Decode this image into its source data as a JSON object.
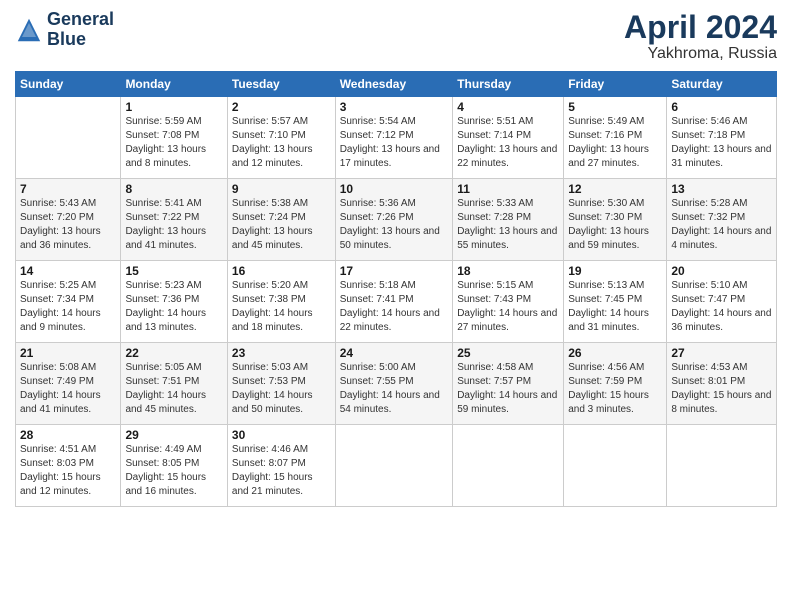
{
  "header": {
    "logo_line1": "General",
    "logo_line2": "Blue",
    "month_year": "April 2024",
    "location": "Yakhroma, Russia"
  },
  "weekdays": [
    "Sunday",
    "Monday",
    "Tuesday",
    "Wednesday",
    "Thursday",
    "Friday",
    "Saturday"
  ],
  "weeks": [
    [
      {
        "day": "",
        "sunrise": "",
        "sunset": "",
        "daylight": ""
      },
      {
        "day": "1",
        "sunrise": "Sunrise: 5:59 AM",
        "sunset": "Sunset: 7:08 PM",
        "daylight": "Daylight: 13 hours and 8 minutes."
      },
      {
        "day": "2",
        "sunrise": "Sunrise: 5:57 AM",
        "sunset": "Sunset: 7:10 PM",
        "daylight": "Daylight: 13 hours and 12 minutes."
      },
      {
        "day": "3",
        "sunrise": "Sunrise: 5:54 AM",
        "sunset": "Sunset: 7:12 PM",
        "daylight": "Daylight: 13 hours and 17 minutes."
      },
      {
        "day": "4",
        "sunrise": "Sunrise: 5:51 AM",
        "sunset": "Sunset: 7:14 PM",
        "daylight": "Daylight: 13 hours and 22 minutes."
      },
      {
        "day": "5",
        "sunrise": "Sunrise: 5:49 AM",
        "sunset": "Sunset: 7:16 PM",
        "daylight": "Daylight: 13 hours and 27 minutes."
      },
      {
        "day": "6",
        "sunrise": "Sunrise: 5:46 AM",
        "sunset": "Sunset: 7:18 PM",
        "daylight": "Daylight: 13 hours and 31 minutes."
      }
    ],
    [
      {
        "day": "7",
        "sunrise": "Sunrise: 5:43 AM",
        "sunset": "Sunset: 7:20 PM",
        "daylight": "Daylight: 13 hours and 36 minutes."
      },
      {
        "day": "8",
        "sunrise": "Sunrise: 5:41 AM",
        "sunset": "Sunset: 7:22 PM",
        "daylight": "Daylight: 13 hours and 41 minutes."
      },
      {
        "day": "9",
        "sunrise": "Sunrise: 5:38 AM",
        "sunset": "Sunset: 7:24 PM",
        "daylight": "Daylight: 13 hours and 45 minutes."
      },
      {
        "day": "10",
        "sunrise": "Sunrise: 5:36 AM",
        "sunset": "Sunset: 7:26 PM",
        "daylight": "Daylight: 13 hours and 50 minutes."
      },
      {
        "day": "11",
        "sunrise": "Sunrise: 5:33 AM",
        "sunset": "Sunset: 7:28 PM",
        "daylight": "Daylight: 13 hours and 55 minutes."
      },
      {
        "day": "12",
        "sunrise": "Sunrise: 5:30 AM",
        "sunset": "Sunset: 7:30 PM",
        "daylight": "Daylight: 13 hours and 59 minutes."
      },
      {
        "day": "13",
        "sunrise": "Sunrise: 5:28 AM",
        "sunset": "Sunset: 7:32 PM",
        "daylight": "Daylight: 14 hours and 4 minutes."
      }
    ],
    [
      {
        "day": "14",
        "sunrise": "Sunrise: 5:25 AM",
        "sunset": "Sunset: 7:34 PM",
        "daylight": "Daylight: 14 hours and 9 minutes."
      },
      {
        "day": "15",
        "sunrise": "Sunrise: 5:23 AM",
        "sunset": "Sunset: 7:36 PM",
        "daylight": "Daylight: 14 hours and 13 minutes."
      },
      {
        "day": "16",
        "sunrise": "Sunrise: 5:20 AM",
        "sunset": "Sunset: 7:38 PM",
        "daylight": "Daylight: 14 hours and 18 minutes."
      },
      {
        "day": "17",
        "sunrise": "Sunrise: 5:18 AM",
        "sunset": "Sunset: 7:41 PM",
        "daylight": "Daylight: 14 hours and 22 minutes."
      },
      {
        "day": "18",
        "sunrise": "Sunrise: 5:15 AM",
        "sunset": "Sunset: 7:43 PM",
        "daylight": "Daylight: 14 hours and 27 minutes."
      },
      {
        "day": "19",
        "sunrise": "Sunrise: 5:13 AM",
        "sunset": "Sunset: 7:45 PM",
        "daylight": "Daylight: 14 hours and 31 minutes."
      },
      {
        "day": "20",
        "sunrise": "Sunrise: 5:10 AM",
        "sunset": "Sunset: 7:47 PM",
        "daylight": "Daylight: 14 hours and 36 minutes."
      }
    ],
    [
      {
        "day": "21",
        "sunrise": "Sunrise: 5:08 AM",
        "sunset": "Sunset: 7:49 PM",
        "daylight": "Daylight: 14 hours and 41 minutes."
      },
      {
        "day": "22",
        "sunrise": "Sunrise: 5:05 AM",
        "sunset": "Sunset: 7:51 PM",
        "daylight": "Daylight: 14 hours and 45 minutes."
      },
      {
        "day": "23",
        "sunrise": "Sunrise: 5:03 AM",
        "sunset": "Sunset: 7:53 PM",
        "daylight": "Daylight: 14 hours and 50 minutes."
      },
      {
        "day": "24",
        "sunrise": "Sunrise: 5:00 AM",
        "sunset": "Sunset: 7:55 PM",
        "daylight": "Daylight: 14 hours and 54 minutes."
      },
      {
        "day": "25",
        "sunrise": "Sunrise: 4:58 AM",
        "sunset": "Sunset: 7:57 PM",
        "daylight": "Daylight: 14 hours and 59 minutes."
      },
      {
        "day": "26",
        "sunrise": "Sunrise: 4:56 AM",
        "sunset": "Sunset: 7:59 PM",
        "daylight": "Daylight: 15 hours and 3 minutes."
      },
      {
        "day": "27",
        "sunrise": "Sunrise: 4:53 AM",
        "sunset": "Sunset: 8:01 PM",
        "daylight": "Daylight: 15 hours and 8 minutes."
      }
    ],
    [
      {
        "day": "28",
        "sunrise": "Sunrise: 4:51 AM",
        "sunset": "Sunset: 8:03 PM",
        "daylight": "Daylight: 15 hours and 12 minutes."
      },
      {
        "day": "29",
        "sunrise": "Sunrise: 4:49 AM",
        "sunset": "Sunset: 8:05 PM",
        "daylight": "Daylight: 15 hours and 16 minutes."
      },
      {
        "day": "30",
        "sunrise": "Sunrise: 4:46 AM",
        "sunset": "Sunset: 8:07 PM",
        "daylight": "Daylight: 15 hours and 21 minutes."
      },
      {
        "day": "",
        "sunrise": "",
        "sunset": "",
        "daylight": ""
      },
      {
        "day": "",
        "sunrise": "",
        "sunset": "",
        "daylight": ""
      },
      {
        "day": "",
        "sunrise": "",
        "sunset": "",
        "daylight": ""
      },
      {
        "day": "",
        "sunrise": "",
        "sunset": "",
        "daylight": ""
      }
    ]
  ]
}
